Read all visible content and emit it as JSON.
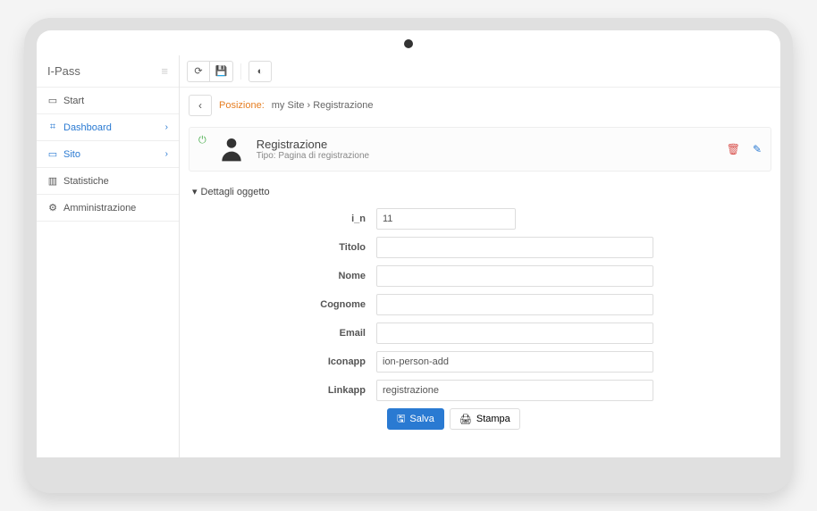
{
  "brand": "I-Pass",
  "sidebar": {
    "items": [
      {
        "icon": "▭",
        "label": "Start"
      },
      {
        "icon": "⚙",
        "label": "Dashboard",
        "active": true,
        "expandable": true
      },
      {
        "icon": "▭",
        "label": "Sito",
        "active": true,
        "expandable": true
      },
      {
        "icon": "📊",
        "label": "Statistiche"
      },
      {
        "icon": "⚙",
        "label": "Amministrazione"
      }
    ]
  },
  "breadcrumb": {
    "label": "Posizione:",
    "path": "my Site › Registrazione"
  },
  "panel": {
    "title": "Registrazione",
    "subtitle_prefix": "Tipo:",
    "subtitle_value": "Pagina di registrazione"
  },
  "section": {
    "title": "Dettagli oggetto"
  },
  "form": {
    "fields": [
      {
        "label": "i_n",
        "value": "11",
        "small": true
      },
      {
        "label": "Titolo",
        "value": ""
      },
      {
        "label": "Nome",
        "value": ""
      },
      {
        "label": "Cognome",
        "value": ""
      },
      {
        "label": "Email",
        "value": ""
      },
      {
        "label": "Iconapp",
        "value": "ion-person-add"
      },
      {
        "label": "Linkapp",
        "value": "registrazione"
      }
    ],
    "save_label": "Salva",
    "print_label": "Stampa"
  },
  "colors": {
    "accent": "#2a7ad2",
    "warn": "#e67e22",
    "danger": "#d9534f",
    "ok": "#4caf50"
  }
}
